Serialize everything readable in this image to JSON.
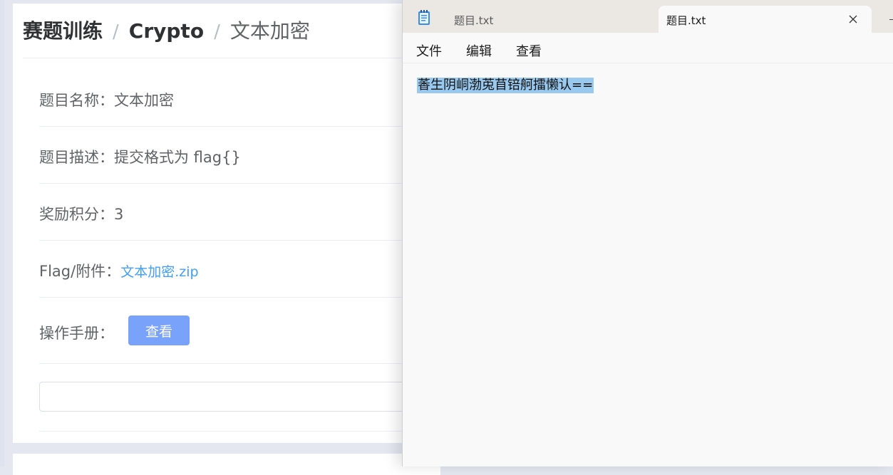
{
  "web": {
    "breadcrumb": [
      "赛题训练",
      "Crypto",
      "文本加密"
    ],
    "separator": "/",
    "rows": {
      "name_label": "题目名称：",
      "name_value": "文本加密",
      "desc_label": "题目描述：",
      "desc_value": "提交格式为 flag{}",
      "points_label": "奖励积分：",
      "points_value": "3",
      "attach_label": "Flag/附件：",
      "attach_link": "文本加密.zip",
      "manual_label": "操作手册：",
      "manual_button": "查看"
    },
    "flag_input": {
      "value": "",
      "placeholder": ""
    },
    "colors": {
      "button": "#79a2fb",
      "link": "#409eff"
    }
  },
  "notepad": {
    "icon": "notepad-icon",
    "tabs": [
      {
        "title": "题目.txt",
        "active": false
      },
      {
        "title": "题目.txt",
        "active": true
      }
    ],
    "close_icon": "close-icon",
    "menu": [
      "文件",
      "编辑",
      "查看"
    ],
    "content": "萫生阴峒渤莵苜锫舸擂懒认=="
  }
}
